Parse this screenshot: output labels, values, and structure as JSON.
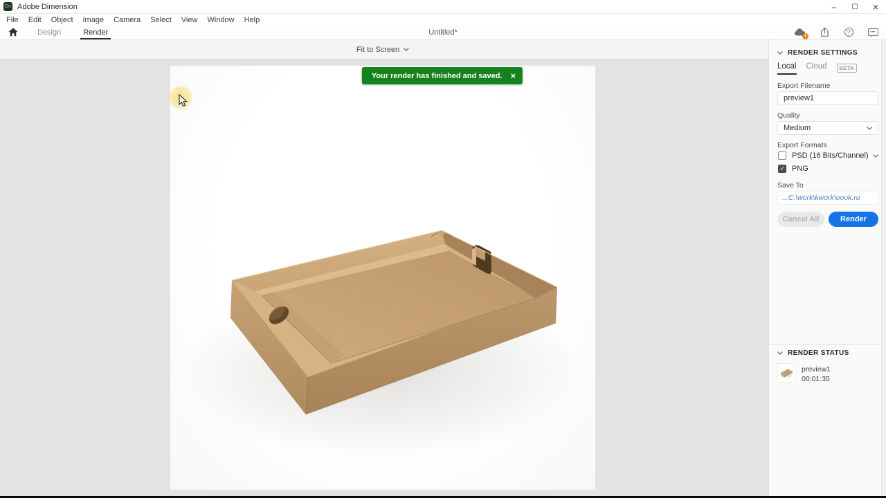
{
  "window": {
    "title": "Adobe Dimension",
    "logo_text": "Dn",
    "controls": {
      "minimize": "–",
      "maximize": "▢",
      "close": "×"
    }
  },
  "menubar": {
    "items": [
      "File",
      "Edit",
      "Object",
      "Image",
      "Camera",
      "Select",
      "View",
      "Window",
      "Help"
    ]
  },
  "tabbar": {
    "design_tab": "Design",
    "render_tab": "Render",
    "document_title": "Untitled*"
  },
  "icons": {
    "cloud_badge": "!",
    "help": "?",
    "chat_dots": "•••"
  },
  "toolbar": {
    "view_control": "Fit to Screen"
  },
  "toast": {
    "message": "Your render has finished and saved.",
    "close_icon": "×"
  },
  "panel": {
    "render_settings": {
      "header": "RENDER SETTINGS",
      "local_tab": "Local",
      "cloud_tab": "Cloud",
      "beta_badge": "BETA",
      "export_filename_label": "Export Filename",
      "export_filename_value": "preview1",
      "quality_label": "Quality",
      "quality_value": "Medium",
      "export_formats_label": "Export Formats",
      "formats": [
        {
          "label": "PSD (16 Bits/Channel)",
          "checked": false
        },
        {
          "label": "PNG",
          "checked": true
        }
      ],
      "checkmark": "✓",
      "save_to_label": "Save To",
      "save_to_value": "...C:\\work\\kwork\\oook.ru",
      "cancel_all_button": "Cancel All",
      "render_button": "Render"
    },
    "render_status": {
      "header": "RENDER STATUS",
      "items": [
        {
          "name": "preview1",
          "duration": "00:01:35"
        }
      ]
    }
  },
  "colors": {
    "accent_blue": "#1473E6",
    "toast_green": "#16821D",
    "cardboard_tan": "#C9A475",
    "badge_orange": "#E68619"
  },
  "scene": {
    "subject": "open cardboard tray box render"
  }
}
